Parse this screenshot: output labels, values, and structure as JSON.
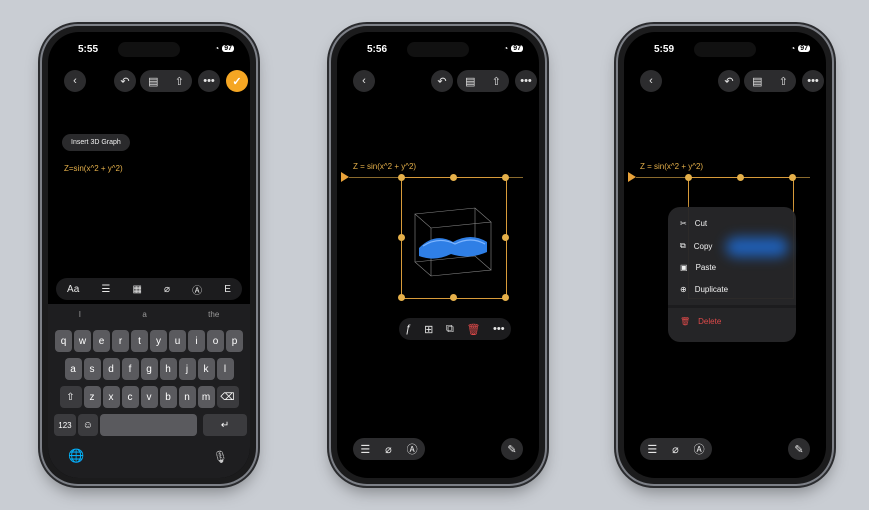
{
  "phone1": {
    "time": "5:55",
    "battery": "97",
    "insert_label": "Insert 3D Graph",
    "formula": "Z=sin(x^2 + y^2)",
    "format_bar": {
      "aa": "Aa",
      "partial": "E"
    },
    "suggestions": [
      "I",
      "a",
      "the"
    ],
    "rows": [
      [
        "q",
        "w",
        "e",
        "r",
        "t",
        "y",
        "u",
        "i",
        "o",
        "p"
      ],
      [
        "a",
        "s",
        "d",
        "f",
        "g",
        "h",
        "j",
        "k",
        "l"
      ],
      [
        "z",
        "x",
        "c",
        "v",
        "b",
        "n",
        "m"
      ]
    ],
    "num_key": "123"
  },
  "phone2": {
    "time": "5:56",
    "battery": "97",
    "formula": "Z = sin(x^2 + y^2)"
  },
  "phone3": {
    "time": "5:59",
    "battery": "97",
    "formula": "Z = sin(x^2 + y^2)",
    "menu": [
      "Cut",
      "Copy",
      "Paste",
      "Duplicate"
    ],
    "delete_label": "Delete"
  },
  "colors": {
    "accent": "#f5a623",
    "formula": "#e5b04a",
    "delete": "#e04a4a",
    "surface": "#55585d"
  }
}
